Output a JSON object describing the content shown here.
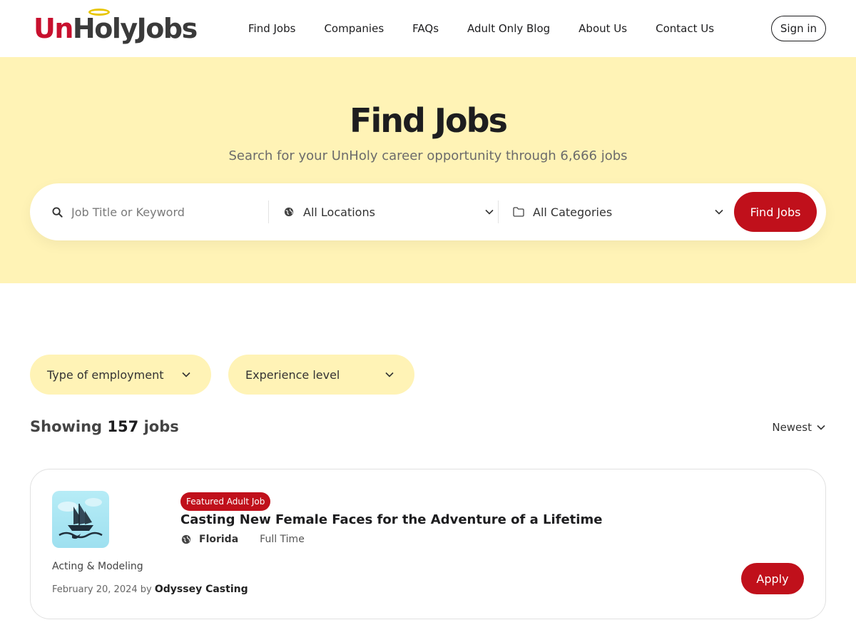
{
  "brand": {
    "logo_un": "Un",
    "logo_holy": "Holy",
    "logo_jobs": "Jobs",
    "accent": "#c0101b",
    "hero_bg": "#fff3b6"
  },
  "nav": {
    "items": [
      {
        "label": "Find Jobs"
      },
      {
        "label": "Companies"
      },
      {
        "label": "FAQs"
      },
      {
        "label": "Adult Only Blog"
      },
      {
        "label": "About Us"
      },
      {
        "label": "Contact Us"
      }
    ],
    "signin": "Sign in"
  },
  "hero": {
    "title": "Find Jobs",
    "subtitle": "Search for your UnHoly career opportunity through 6,666 jobs"
  },
  "search": {
    "keyword_placeholder": "Job Title or Keyword",
    "location_value": "All Locations",
    "category_value": "All Categories",
    "submit_label": "Find Jobs"
  },
  "filters": {
    "type_label": "Type of employment",
    "experience_label": "Experience level"
  },
  "results": {
    "prefix": "Showing",
    "count": "157",
    "suffix": "jobs",
    "sort_label": "Newest"
  },
  "jobs": [
    {
      "badge": "Featured Adult Job",
      "title": "Casting New Female Faces for the Adventure of a Lifetime",
      "location": "Florida",
      "type": "Full Time",
      "category": "Acting & Modeling",
      "date": "February 20, 2024 by",
      "company": "Odyssey Casting",
      "apply_label": "Apply"
    }
  ]
}
